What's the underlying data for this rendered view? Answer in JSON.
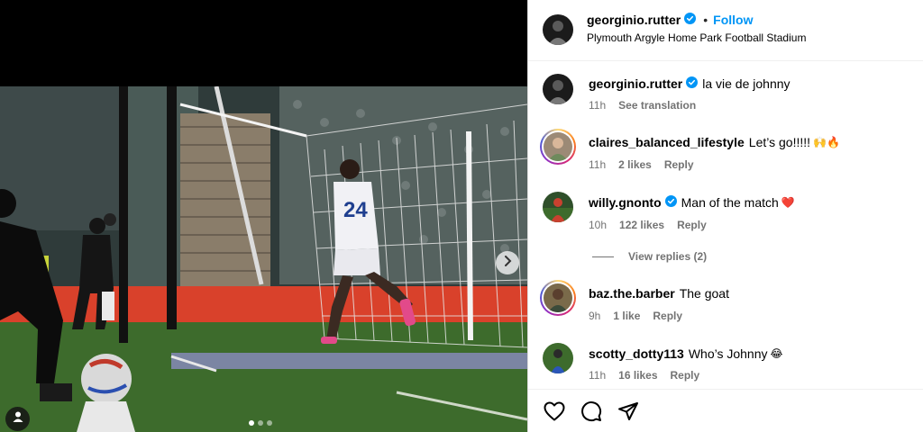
{
  "post": {
    "author": "georginio.rutter",
    "follow_label": "Follow",
    "separator": "•",
    "location": "Plymouth Argyle Home Park Football Stadium",
    "carousel": {
      "total": 3,
      "active_index": 0
    },
    "player_shirt_number": "24"
  },
  "comments": [
    {
      "user": "georginio.rutter",
      "verified": true,
      "text": "la vie de johnny",
      "emoji": "",
      "time": "11h",
      "likes": "",
      "action": "See translation"
    },
    {
      "user": "claires_balanced_lifestyle",
      "verified": false,
      "text": "Let’s go!!!!!",
      "emoji": "🙌🔥",
      "time": "11h",
      "likes": "2 likes",
      "action": "Reply"
    },
    {
      "user": "willy.gnonto",
      "verified": true,
      "text": "Man of the match",
      "emoji": "❤️",
      "time": "10h",
      "likes": "122 likes",
      "action": "Reply"
    },
    {
      "user": "baz.the.barber",
      "verified": false,
      "text": "The goat",
      "emoji": "",
      "time": "9h",
      "likes": "1 like",
      "action": "Reply"
    },
    {
      "user": "scotty_dotty113",
      "verified": false,
      "text": "Who’s Johnny",
      "emoji": "😂",
      "time": "11h",
      "likes": "16 likes",
      "action": "Reply"
    }
  ],
  "view_replies": "View replies (2)",
  "colors": {
    "accent": "#0095f6",
    "verified": "#0095f6",
    "muted": "#737373"
  },
  "icons": [
    "heart-icon",
    "comment-icon",
    "share-icon",
    "next-arrow-icon",
    "tag-person-icon",
    "verified-badge-icon"
  ]
}
